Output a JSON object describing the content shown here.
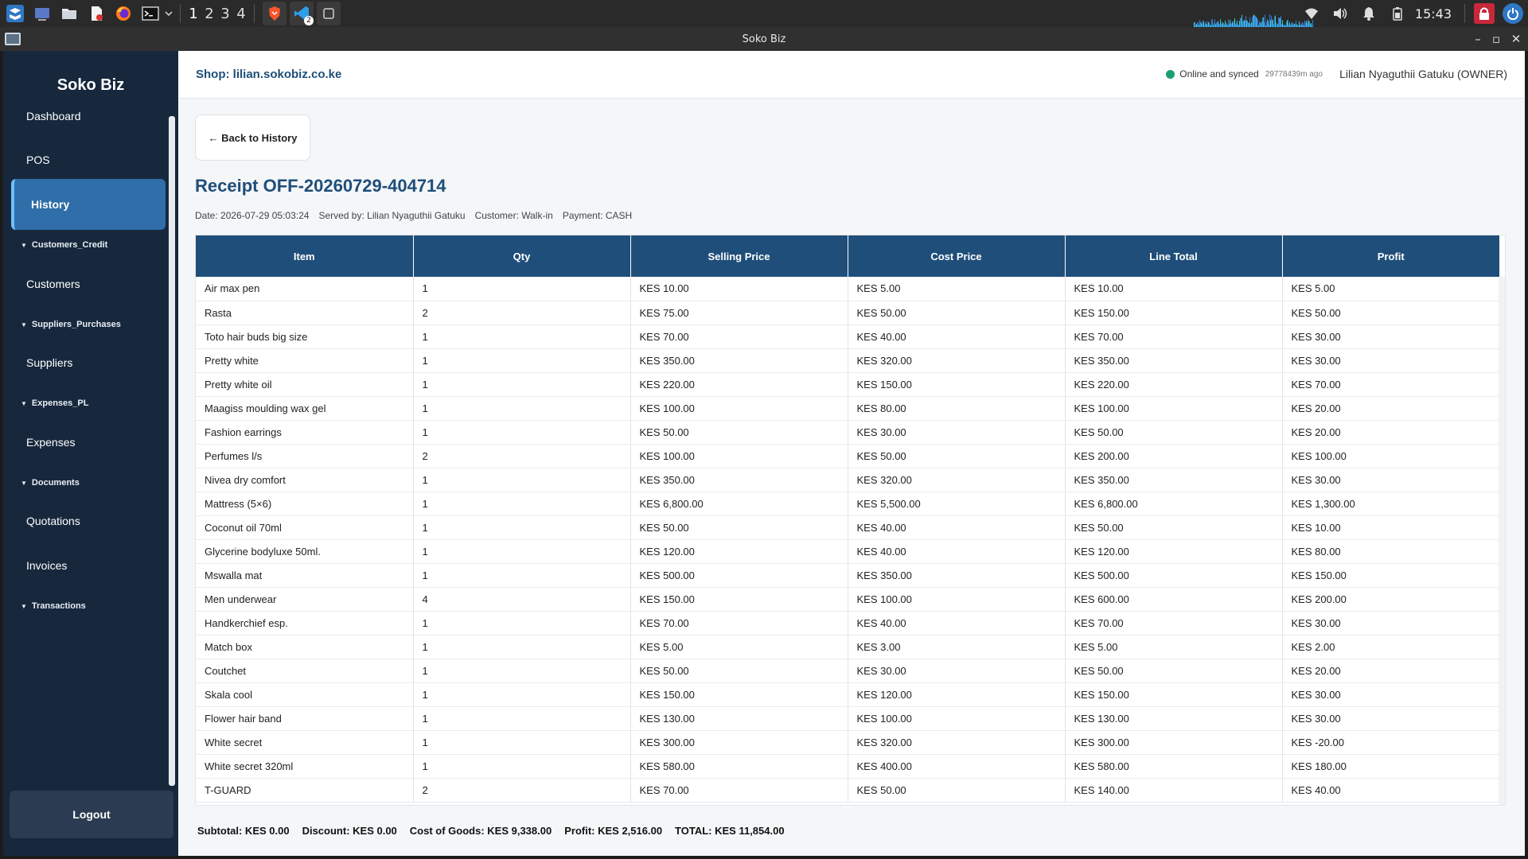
{
  "os": {
    "workspaces": [
      "1",
      "2",
      "3",
      "4"
    ],
    "clock": "15:43",
    "vscode_badge": "2"
  },
  "window": {
    "title": "Soko Biz"
  },
  "sidebar": {
    "brand": "Soko Biz",
    "items": [
      {
        "label": "Dashboard",
        "type": "item"
      },
      {
        "label": "POS",
        "type": "item"
      },
      {
        "label": "History",
        "type": "item",
        "active": true
      },
      {
        "label": "Customers_Credit",
        "type": "section"
      },
      {
        "label": "Customers",
        "type": "item"
      },
      {
        "label": "Suppliers_Purchases",
        "type": "section"
      },
      {
        "label": "Suppliers",
        "type": "item"
      },
      {
        "label": "Expenses_PL",
        "type": "section"
      },
      {
        "label": "Expenses",
        "type": "item"
      },
      {
        "label": "Documents",
        "type": "section"
      },
      {
        "label": "Quotations",
        "type": "item"
      },
      {
        "label": "Invoices",
        "type": "item"
      },
      {
        "label": "Transactions",
        "type": "section"
      }
    ],
    "logout_label": "Logout"
  },
  "header": {
    "shop": "Shop: lilian.sokobiz.co.ke",
    "sync_status": "Online and synced",
    "sync_ago": "29778439m ago",
    "user": "Lilian Nyaguthii Gatuku (OWNER)"
  },
  "receipt": {
    "back_label": "← Back to History",
    "title": "Receipt OFF-20260729-404714",
    "date": "Date: 2026-07-29 05:03:24",
    "served_by": "Served by: Lilian Nyaguthii Gatuku",
    "customer": "Customer: Walk-in",
    "payment": "Payment: CASH"
  },
  "table": {
    "columns": [
      "Item",
      "Qty",
      "Selling Price",
      "Cost Price",
      "Line Total",
      "Profit"
    ],
    "rows": [
      [
        "Air max pen",
        "1",
        "KES 10.00",
        "KES 5.00",
        "KES 10.00",
        "KES 5.00"
      ],
      [
        "Rasta",
        "2",
        "KES 75.00",
        "KES 50.00",
        "KES 150.00",
        "KES 50.00"
      ],
      [
        "Toto hair buds big size",
        "1",
        "KES 70.00",
        "KES 40.00",
        "KES 70.00",
        "KES 30.00"
      ],
      [
        "Pretty white",
        "1",
        "KES 350.00",
        "KES 320.00",
        "KES 350.00",
        "KES 30.00"
      ],
      [
        "Pretty white oil",
        "1",
        "KES 220.00",
        "KES 150.00",
        "KES 220.00",
        "KES 70.00"
      ],
      [
        "Maagiss moulding wax gel",
        "1",
        "KES 100.00",
        "KES 80.00",
        "KES 100.00",
        "KES 20.00"
      ],
      [
        "Fashion earrings",
        "1",
        "KES 50.00",
        "KES 30.00",
        "KES 50.00",
        "KES 20.00"
      ],
      [
        "Perfumes l/s",
        "2",
        "KES 100.00",
        "KES 50.00",
        "KES 200.00",
        "KES 100.00"
      ],
      [
        "Nivea dry comfort",
        "1",
        "KES 350.00",
        "KES 320.00",
        "KES 350.00",
        "KES 30.00"
      ],
      [
        "Mattress (5×6)",
        "1",
        "KES 6,800.00",
        "KES 5,500.00",
        "KES 6,800.00",
        "KES 1,300.00"
      ],
      [
        "Coconut oil 70ml",
        "1",
        "KES 50.00",
        "KES 40.00",
        "KES 50.00",
        "KES 10.00"
      ],
      [
        "Glycerine bodyluxe 50ml.",
        "1",
        "KES 120.00",
        "KES 40.00",
        "KES 120.00",
        "KES 80.00"
      ],
      [
        "Mswalla mat",
        "1",
        "KES 500.00",
        "KES 350.00",
        "KES 500.00",
        "KES 150.00"
      ],
      [
        "Men underwear",
        "4",
        "KES 150.00",
        "KES 100.00",
        "KES 600.00",
        "KES 200.00"
      ],
      [
        "Handkerchief esp.",
        "1",
        "KES 70.00",
        "KES 40.00",
        "KES 70.00",
        "KES 30.00"
      ],
      [
        "Match box",
        "1",
        "KES 5.00",
        "KES 3.00",
        "KES 5.00",
        "KES 2.00"
      ],
      [
        "Coutchet",
        "1",
        "KES 50.00",
        "KES 30.00",
        "KES 50.00",
        "KES 20.00"
      ],
      [
        "Skala cool",
        "1",
        "KES 150.00",
        "KES 120.00",
        "KES 150.00",
        "KES 30.00"
      ],
      [
        "Flower hair band",
        "1",
        "KES 130.00",
        "KES 100.00",
        "KES 130.00",
        "KES 30.00"
      ],
      [
        "White secret",
        "1",
        "KES 300.00",
        "KES 320.00",
        "KES 300.00",
        "KES -20.00"
      ],
      [
        "White secret 320ml",
        "1",
        "KES 580.00",
        "KES 400.00",
        "KES 580.00",
        "KES 180.00"
      ],
      [
        "T-GUARD",
        "2",
        "KES 70.00",
        "KES 50.00",
        "KES 140.00",
        "KES 40.00"
      ]
    ]
  },
  "summary": {
    "subtotal": "Subtotal: KES 0.00",
    "discount": "Discount: KES 0.00",
    "cost": "Cost of Goods: KES 9,338.00",
    "profit": "Profit: KES 2,516.00",
    "total": "TOTAL: KES 11,854.00"
  },
  "colors": {
    "sidebar_bg": "#17283d",
    "accent": "#1f4e7a",
    "active_nav": "#2f6ea8",
    "online": "#1e9e6e"
  }
}
